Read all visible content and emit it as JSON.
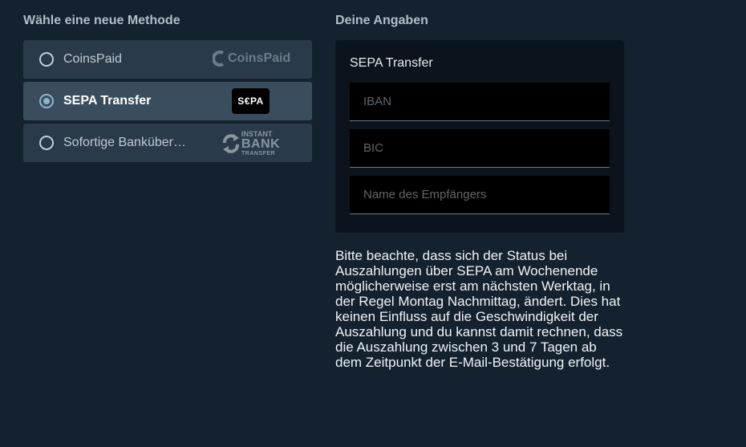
{
  "left": {
    "title": "Wähle eine neue Methode",
    "methods": [
      {
        "label": "CoinsPaid",
        "logo_text": "CoinsPaid",
        "logo_icon": "coinspaid-logo",
        "selected": false
      },
      {
        "label": "SEPA Transfer",
        "logo_text": "S€PA",
        "logo_icon": "sepa-logo",
        "selected": true
      },
      {
        "label": "Sofortige Banküber…",
        "logo_line1": "INSTANT",
        "logo_line2": "BANK",
        "logo_line3": "TRANSFER",
        "logo_icon": "instant-bank-transfer-logo",
        "selected": false
      }
    ]
  },
  "right": {
    "title": "Deine Angaben",
    "card_title": "SEPA Transfer",
    "fields": {
      "iban_placeholder": "IBAN",
      "bic_placeholder": "BIC",
      "name_placeholder": "Name des Empfängers"
    },
    "notice": "Bitte beachte, dass sich der Status bei Auszahlungen über SEPA am Wochenende möglicherweise erst am nächsten Werktag, in der Regel Montag Nachmittag, ändert. Dies hat keinen Einfluss auf die Geschwindigkeit der Auszahlung und du kannst damit rechnen, dass die Auszahlung zwischen 3 und 7 Tagen ab dem Zeitpunkt der E-Mail-Bestätigung erfolgt."
  },
  "colors": {
    "background": "#14212e",
    "method_bg": "#2a3a4a",
    "method_selected_bg": "#3a4d5f",
    "card_bg": "#0b141c",
    "radio_selected": "#8fb3c8"
  }
}
